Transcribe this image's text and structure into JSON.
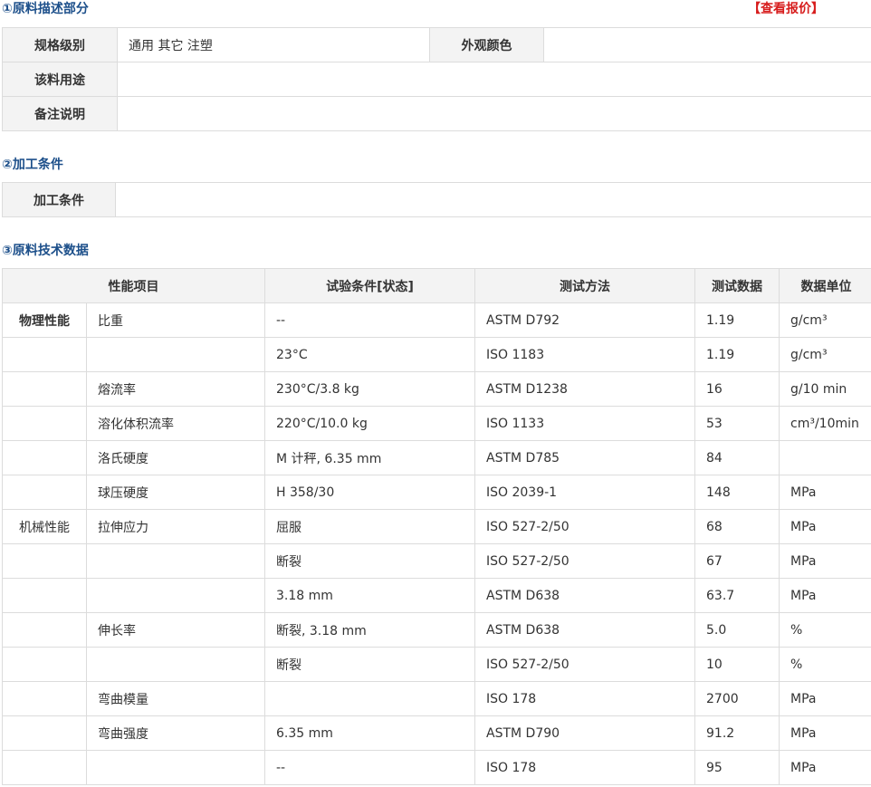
{
  "section1": {
    "title": "①原料描述部分",
    "quote_link": "【查看报价】",
    "rows": [
      {
        "label": "规格级别",
        "value": "通用 其它 注塑",
        "label2": "外观颜色",
        "value2": ""
      },
      {
        "label": "该料用途",
        "value": ""
      },
      {
        "label": "备注说明",
        "value": ""
      }
    ]
  },
  "section2": {
    "title": "②加工条件",
    "label": "加工条件",
    "value": ""
  },
  "section3": {
    "title": "③原料技术数据",
    "headers": [
      "性能项目",
      "试验条件[状态]",
      "测试方法",
      "测试数据",
      "数据单位"
    ],
    "rows": [
      {
        "cat": "物理性能",
        "prop": "比重",
        "cond": "--",
        "method": "ASTM D792",
        "value": "1.19",
        "unit": "g/cm³"
      },
      {
        "cat": "",
        "prop": "",
        "cond": "23°C",
        "method": "ISO 1183",
        "value": "1.19",
        "unit": "g/cm³"
      },
      {
        "cat": "",
        "prop": "熔流率",
        "cond": "230°C/3.8 kg",
        "method": "ASTM D1238",
        "value": "16",
        "unit": "g/10 min"
      },
      {
        "cat": "",
        "prop": "溶化体积流率",
        "cond": "220°C/10.0 kg",
        "method": "ISO 1133",
        "value": "53",
        "unit": "cm³/10min"
      },
      {
        "cat": "",
        "prop": "洛氏硬度",
        "cond": "M 计秤, 6.35 mm",
        "method": "ASTM D785",
        "value": "84",
        "unit": ""
      },
      {
        "cat": "",
        "prop": "球压硬度",
        "cond": "H 358/30",
        "method": "ISO 2039-1",
        "value": "148",
        "unit": "MPa"
      },
      {
        "cat": "机械性能",
        "prop": "拉伸应力",
        "cond": "屈服",
        "method": "ISO 527-2/50",
        "value": "68",
        "unit": "MPa"
      },
      {
        "cat": "",
        "prop": "",
        "cond": "断裂",
        "method": "ISO 527-2/50",
        "value": "67",
        "unit": "MPa"
      },
      {
        "cat": "",
        "prop": "",
        "cond": "3.18 mm",
        "method": "ASTM D638",
        "value": "63.7",
        "unit": "MPa"
      },
      {
        "cat": "",
        "prop": "伸长率",
        "cond": "断裂, 3.18 mm",
        "method": "ASTM D638",
        "value": "5.0",
        "unit": "%"
      },
      {
        "cat": "",
        "prop": "",
        "cond": "断裂",
        "method": "ISO 527-2/50",
        "value": "10",
        "unit": "%"
      },
      {
        "cat": "",
        "prop": "弯曲模量",
        "cond": "",
        "method": "ISO 178",
        "value": "2700",
        "unit": "MPa"
      },
      {
        "cat": "",
        "prop": "弯曲强度",
        "cond": "6.35 mm",
        "method": "ASTM D790",
        "value": "91.2",
        "unit": "MPa"
      },
      {
        "cat": "",
        "prop": "",
        "cond": "--",
        "method": "ISO 178",
        "value": "95",
        "unit": "MPa"
      }
    ]
  }
}
